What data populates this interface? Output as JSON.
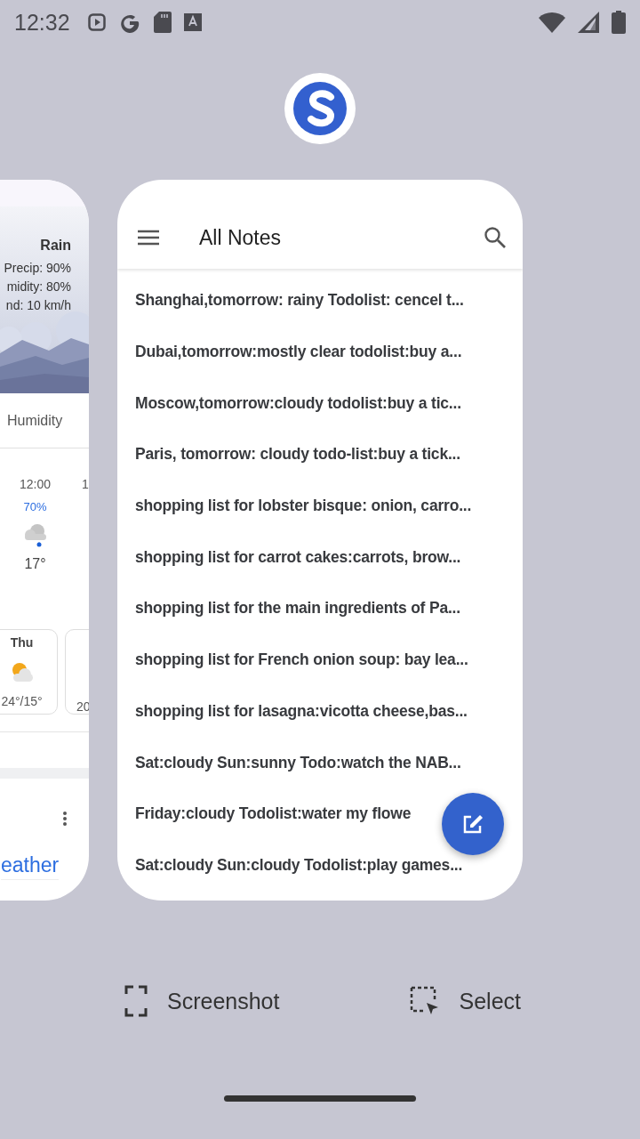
{
  "status_bar": {
    "time": "12:32"
  },
  "recent_apps": {
    "weather_card": {
      "condition": "Rain",
      "details": [
        "Precip: 90%",
        "midity: 80%",
        "nd: 10 km/h"
      ],
      "tab": "Humidity",
      "hourly": [
        {
          "time": "12:00",
          "precip": "70%",
          "temp": "17°"
        },
        {
          "time": "1"
        }
      ],
      "daily": [
        {
          "day": "Thu",
          "temps": "24°/15°"
        },
        {
          "temps": "20"
        }
      ],
      "link": "eather"
    },
    "notes_card": {
      "title": "All Notes",
      "notes": [
        "Shanghai,tomorrow: rainy Todolist: cencel t...",
        "Dubai,tomorrow:mostly clear todolist:buy a...",
        "Moscow,tomorrow:cloudy todolist:buy a tic...",
        "Paris, tomorrow: cloudy todo-list:buy a tick...",
        "shopping list for lobster bisque: onion, carro...",
        "shopping list for carrot cakes:carrots, brow...",
        "shopping list for the main ingredients of Pa...",
        "shopping list for French onion soup: bay lea...",
        "shopping list for lasagna:vicotta cheese,bas...",
        "Sat:cloudy Sun:sunny Todo:watch the NAB...",
        "Friday:cloudy Todolist:water my flowe",
        "Sat:cloudy Sun:cloudy Todolist:play games..."
      ]
    }
  },
  "actions": [
    "Screenshot",
    "Select"
  ]
}
